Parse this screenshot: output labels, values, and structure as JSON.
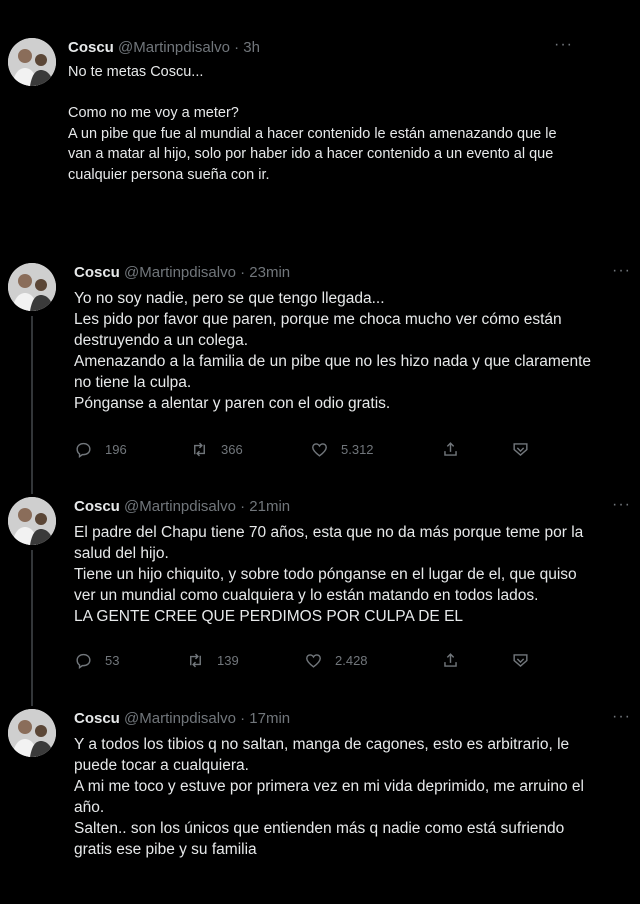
{
  "tweets": [
    {
      "name": "Coscu",
      "handle": "@Martinpdisalvo",
      "time": "3h",
      "lines": [
        "No te metas Coscu...",
        "",
        "Como no me voy a meter?",
        "A un pibe que fue al mundial a hacer contenido le están amenazando que le",
        "van a matar al hijo, solo por haber ido a hacer contenido a un evento al que",
        "cualquier persona sueña con ir."
      ]
    },
    {
      "name": "Coscu",
      "handle": "@Martinpdisalvo",
      "time": "23min",
      "lines": [
        "Yo no soy nadie, pero se que tengo llegada...",
        "Les pido por favor que paren, porque me choca mucho ver cómo están",
        "destruyendo a un colega.",
        "Amenazando a la familia de un pibe que no les hizo nada y que claramente",
        "no tiene la culpa.",
        "Pónganse a alentar y paren con el odio gratis."
      ],
      "replies": "196",
      "retweets": "366",
      "likes": "5.312"
    },
    {
      "name": "Coscu",
      "handle": "@Martinpdisalvo",
      "time": "21min",
      "lines": [
        "El padre del Chapu tiene 70 años, esta que no da más porque teme por la",
        "salud del hijo.",
        "Tiene un hijo chiquito, y sobre todo pónganse en el lugar de el, que quiso",
        "ver un mundial como cualquiera y lo están matando en todos lados.",
        "LA GENTE CREE QUE PERDIMOS POR CULPA DE EL"
      ],
      "replies": "53",
      "retweets": "139",
      "likes": "2.428"
    },
    {
      "name": "Coscu",
      "handle": "@Martinpdisalvo",
      "time": "17min",
      "lines": [
        "Y a todos los tibios q no saltan, manga de cagones, esto es arbitrario, le",
        "puede tocar a cualquiera.",
        "A mi me toco y estuve por primera vez en mi vida deprimido, me arruino el",
        "año.",
        "Salten.. son los únicos que entienden más q nadie como está sufriendo",
        "gratis ese pibe y su familia"
      ]
    }
  ],
  "ui": {
    "separator": " · ",
    "more": "···"
  },
  "icons": {
    "avatar": "profile-photo",
    "reply": "reply-icon",
    "retweet": "retweet-icon",
    "like": "heart-icon",
    "share": "share-icon",
    "bookmark": "bookmark-icon",
    "more": "more-icon"
  }
}
